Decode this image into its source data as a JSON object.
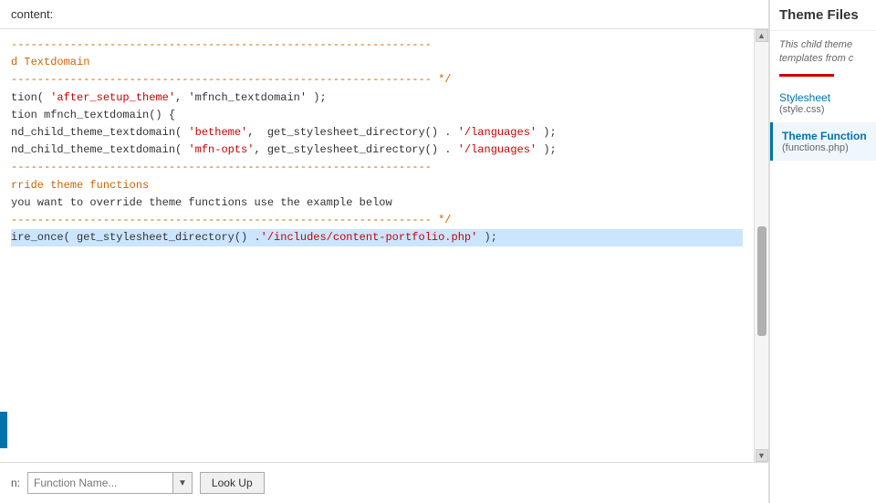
{
  "header": {
    "label": "content:"
  },
  "sidebar": {
    "title": "Theme Files",
    "description": "This child theme templates from c",
    "underline_color": "#cc0000",
    "items": [
      {
        "title": "Stylesheet",
        "subtitle": "(style.css)",
        "active": false
      },
      {
        "title": "Theme Function",
        "subtitle": "(functions.php)",
        "active": true
      }
    ]
  },
  "code": {
    "lines": [
      {
        "text": "----------------------------------------------------------------",
        "type": "dashed"
      },
      {
        "text": "d Textdomain",
        "type": "comment"
      },
      {
        "text": "",
        "type": "normal"
      },
      {
        "text": "---------------------------------------------------------------- */",
        "type": "dashed"
      },
      {
        "text": "tion( 'after_setup_theme', 'mfnch_textdomain' );",
        "type": "normal"
      },
      {
        "text": "",
        "type": "normal"
      },
      {
        "text": "tion mfnch_textdomain() {",
        "type": "normal"
      },
      {
        "text": "nd_child_theme_textdomain( 'betheme',  get_stylesheet_directory() . '/languages' );",
        "type": "normal"
      },
      {
        "text": "nd_child_theme_textdomain( 'mfn-opts', get_stylesheet_directory() . '/languages' );",
        "type": "normal"
      },
      {
        "text": "",
        "type": "normal"
      },
      {
        "text": "",
        "type": "normal"
      },
      {
        "text": "",
        "type": "normal"
      },
      {
        "text": "----------------------------------------------------------------",
        "type": "dashed"
      },
      {
        "text": "rride theme functions",
        "type": "comment"
      },
      {
        "text": "",
        "type": "normal"
      },
      {
        "text": "you want to override theme functions use the example below",
        "type": "normal"
      },
      {
        "text": "---------------------------------------------------------------- */",
        "type": "dashed"
      },
      {
        "text": "ire_once( get_stylesheet_directory() .'/includes/content-portfolio.php' );",
        "type": "highlighted"
      }
    ]
  },
  "footer": {
    "label": "n:",
    "input_placeholder": "Function Name...",
    "button_label": "Look Up"
  },
  "scrollbar": {
    "up_arrow": "▲",
    "down_arrow": "▼"
  }
}
